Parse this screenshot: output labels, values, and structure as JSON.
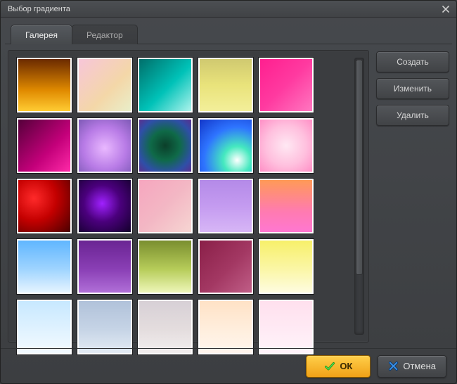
{
  "window": {
    "title": "Выбор градиента"
  },
  "tabs": {
    "gallery": "Галерея",
    "editor": "Редактор"
  },
  "side": {
    "create": "Создать",
    "edit": "Изменить",
    "delete": "Удалить"
  },
  "footer": {
    "ok": "ОК",
    "cancel": "Отмена"
  },
  "colors": {
    "accent_ok_top": "#ffcf4a",
    "accent_ok_bottom": "#f0a117",
    "ok_icon": "#2fbf2f",
    "cancel_icon": "#2a7bd4"
  },
  "swatches": [
    {
      "css": "linear-gradient(180deg,#6b2a00 0%,#e08a00 60%,#ffcc33 100%)"
    },
    {
      "css": "linear-gradient(135deg,#f7c6d9 0%,#f4d7a8 60%,#e9eec9 100%)"
    },
    {
      "css": "linear-gradient(135deg,#006f6a 0%,#00c2b8 55%,#aef3ec 100%)"
    },
    {
      "css": "linear-gradient(180deg,#d0c970 0%,#e9e37b 50%,#f3ef9a 100%)"
    },
    {
      "css": "linear-gradient(135deg,#ff1f8f 0%,#ff3aa0 50%,#ff77c0 100%)"
    },
    {
      "css": "linear-gradient(135deg,#55003a 0%,#c4007a 60%,#ff2aa8 100%)"
    },
    {
      "css": "radial-gradient(circle at 50% 55%,#e9b8ff 0%,#b87be6 55%,#7d59b6 100%)"
    },
    {
      "css": "radial-gradient(circle at 50% 50%,#0b3f2a 0%,#0f6a48 40%,#2f4fa8 75%,#5a2f8e 100%)"
    },
    {
      "css": "radial-gradient(circle at 72% 78%,#ffffff 0%,#45e9bf 25%,#2e74ff 60%,#1236c9 100%)"
    },
    {
      "css": "radial-gradient(circle at 50% 50%,#ffe8f3 0%,#ffc0de 55%,#ff8fc6 100%)"
    },
    {
      "css": "radial-gradient(circle at 30% 35%,#ff2a2a 0%,#c40000 45%,#4a0000 100%)"
    },
    {
      "css": "radial-gradient(circle at 45% 45%,#a021ff 0%,#4b007d 45%,#12002a 100%)"
    },
    {
      "css": "linear-gradient(135deg,#f6a6bf 0%,#f3b7c4 50%,#f6d5d2 100%)"
    },
    {
      "css": "linear-gradient(180deg,#b48ae8 0%,#c49bf0 50%,#d7b6f6 100%)"
    },
    {
      "css": "linear-gradient(180deg,#ff9a57 0%,#ff7bb0 60%,#ff77d1 100%)"
    },
    {
      "css": "linear-gradient(180deg,#60b6ff 0%,#9fd4ff 55%,#e6f4ff 100%)"
    },
    {
      "css": "linear-gradient(180deg,#6a2493 0%,#8a3fb5 55%,#b06fd8 100%)"
    },
    {
      "css": "linear-gradient(180deg,#7a8e2f 0%,#b6cc59 55%,#eef6b9 100%)"
    },
    {
      "css": "linear-gradient(135deg,#8a1f48 0%,#a33863 55%,#c05e87 100%)"
    },
    {
      "css": "linear-gradient(180deg,#f7f06a 0%,#fbf6a6 55%,#fefce0 100%)"
    },
    {
      "css": "linear-gradient(180deg,#c7e8ff 0%,#e2f3ff 60%,#f3faff 100%)"
    },
    {
      "css": "linear-gradient(180deg,#b1c2da 0%,#c6d4e6 55%,#e4ecf4 100%)"
    },
    {
      "css": "linear-gradient(180deg,#d7d0d6 0%,#e4ddde 55%,#f2eeee 100%)"
    },
    {
      "css": "linear-gradient(180deg,#ffe2c6 0%,#ffeedd 55%,#fff6ee 100%)"
    },
    {
      "css": "linear-gradient(180deg,#ffe0ee 0%,#ffeaf4 55%,#fff4fa 100%)"
    }
  ]
}
